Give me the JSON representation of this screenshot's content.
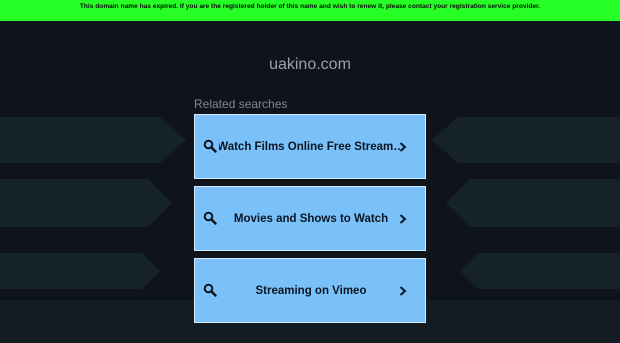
{
  "notice": {
    "text": "This domain name has expired. If you are the registered holder of this name and wish to renew it, please contact your registration service provider."
  },
  "domain": "uakino.com",
  "related_heading": "Related searches",
  "results": [
    {
      "label": "Watch Films Online Free Stream…",
      "icon": "search-icon",
      "arrow": "chevron-right-icon"
    },
    {
      "label": "Movies and Shows to Watch",
      "icon": "search-icon",
      "arrow": "chevron-right-icon"
    },
    {
      "label": "Streaming on Vimeo",
      "icon": "search-icon",
      "arrow": "chevron-right-icon"
    }
  ],
  "colors": {
    "notice_bg": "#25ff25",
    "page_bg": "#0f141b",
    "card_bg": "#7bc1f9"
  }
}
